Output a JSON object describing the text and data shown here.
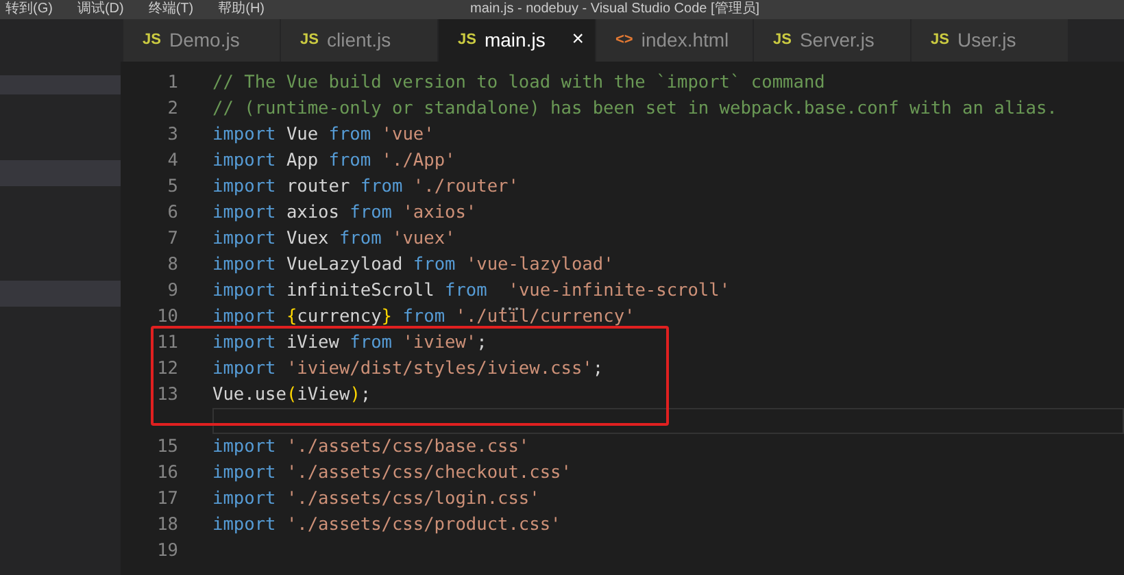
{
  "menu_bar": {
    "items": [
      "转到(G)",
      "调试(D)",
      "终端(T)",
      "帮助(H)"
    ]
  },
  "window": {
    "title": "main.js - nodebuy - Visual Studio Code [管理员]"
  },
  "tabs": [
    {
      "label": "Demo.js",
      "kind": "js",
      "icon": "JS",
      "selected": false
    },
    {
      "label": "client.js",
      "kind": "js",
      "icon": "JS",
      "selected": false
    },
    {
      "label": "main.js",
      "kind": "js",
      "icon": "JS",
      "selected": true,
      "close": "×"
    },
    {
      "label": "index.html",
      "kind": "html",
      "icon": "<>",
      "selected": false
    },
    {
      "label": "Server.js",
      "kind": "js",
      "icon": "JS",
      "selected": false
    },
    {
      "label": "User.js",
      "kind": "js",
      "icon": "JS",
      "selected": false
    }
  ],
  "editor": {
    "lines": [
      {
        "number": "1",
        "tokens": [
          {
            "kind": "comment",
            "text": "// The Vue build version to load with the `import` command"
          }
        ]
      },
      {
        "number": "2",
        "tokens": [
          {
            "kind": "comment",
            "text": "// (runtime-only or standalone) has been set in webpack.base.conf with an alias."
          }
        ]
      },
      {
        "number": "3",
        "tokens": [
          {
            "kind": "keyword",
            "text": "import"
          },
          {
            "kind": "plain",
            "text": " Vue "
          },
          {
            "kind": "keyword",
            "text": "from "
          },
          {
            "kind": "string",
            "text": "'vue'"
          }
        ]
      },
      {
        "number": "4",
        "tokens": [
          {
            "kind": "keyword",
            "text": "import"
          },
          {
            "kind": "plain",
            "text": " App "
          },
          {
            "kind": "keyword",
            "text": "from "
          },
          {
            "kind": "string",
            "text": "'./App'"
          }
        ]
      },
      {
        "number": "5",
        "tokens": [
          {
            "kind": "keyword",
            "text": "import"
          },
          {
            "kind": "plain",
            "text": " router "
          },
          {
            "kind": "keyword",
            "text": "from "
          },
          {
            "kind": "string",
            "text": "'./router'"
          }
        ]
      },
      {
        "number": "6",
        "tokens": [
          {
            "kind": "keyword",
            "text": "import"
          },
          {
            "kind": "plain",
            "text": " axios "
          },
          {
            "kind": "keyword",
            "text": "from "
          },
          {
            "kind": "string",
            "text": "'axios'"
          }
        ]
      },
      {
        "number": "7",
        "tokens": [
          {
            "kind": "keyword",
            "text": "import"
          },
          {
            "kind": "plain",
            "text": " Vuex "
          },
          {
            "kind": "keyword",
            "text": "from "
          },
          {
            "kind": "string",
            "text": "'vuex'"
          }
        ]
      },
      {
        "number": "8",
        "tokens": [
          {
            "kind": "keyword",
            "text": "import"
          },
          {
            "kind": "plain",
            "text": " VueLazyload "
          },
          {
            "kind": "keyword",
            "text": "from "
          },
          {
            "kind": "string",
            "text": "'vue-lazyload'"
          }
        ]
      },
      {
        "number": "9",
        "tokens": [
          {
            "kind": "keyword",
            "text": "import"
          },
          {
            "kind": "plain",
            "text": " infiniteScroll "
          },
          {
            "kind": "keyword",
            "text": "from  "
          },
          {
            "kind": "string",
            "text": "'vue-infinite-scroll'",
            "hint": true
          }
        ]
      },
      {
        "number": "10",
        "tokens": [
          {
            "kind": "keyword",
            "text": "import "
          },
          {
            "kind": "bracket",
            "text": "{"
          },
          {
            "kind": "plain",
            "text": "currency"
          },
          {
            "kind": "bracket",
            "text": "}"
          },
          {
            "kind": "keyword",
            "text": " from "
          },
          {
            "kind": "string",
            "text": "'./util/currency'"
          }
        ]
      },
      {
        "number": "11",
        "boxed": true,
        "tokens": [
          {
            "kind": "keyword",
            "text": "import"
          },
          {
            "kind": "plain",
            "text": " iView "
          },
          {
            "kind": "keyword",
            "text": "from "
          },
          {
            "kind": "string",
            "text": "'iview'"
          },
          {
            "kind": "plain",
            "text": ";"
          }
        ]
      },
      {
        "number": "12",
        "boxed": true,
        "tokens": [
          {
            "kind": "keyword",
            "text": "import "
          },
          {
            "kind": "string",
            "text": "'iview/dist/styles/iview.css'"
          },
          {
            "kind": "plain",
            "text": ";"
          }
        ]
      },
      {
        "number": "13",
        "boxed": true,
        "tokens": [
          {
            "kind": "plain",
            "text": "Vue.use"
          },
          {
            "kind": "bracket",
            "text": "("
          },
          {
            "kind": "plain",
            "text": "iView"
          },
          {
            "kind": "bracket",
            "text": ")"
          },
          {
            "kind": "plain",
            "text": ";"
          }
        ]
      },
      {
        "boxed": true,
        "current": true
      },
      {
        "number": "15",
        "tokens": [
          {
            "kind": "keyword",
            "text": "import "
          },
          {
            "kind": "string",
            "text": "'./assets/css/base.css'"
          }
        ]
      },
      {
        "number": "16",
        "tokens": [
          {
            "kind": "keyword",
            "text": "import "
          },
          {
            "kind": "string",
            "text": "'./assets/css/checkout.css'"
          }
        ]
      },
      {
        "number": "17",
        "tokens": [
          {
            "kind": "keyword",
            "text": "import "
          },
          {
            "kind": "string",
            "text": "'./assets/css/login.css'"
          }
        ]
      },
      {
        "number": "18",
        "tokens": [
          {
            "kind": "keyword",
            "text": "import "
          },
          {
            "kind": "string",
            "text": "'./assets/css/product.css'"
          }
        ]
      },
      {
        "number": "19"
      }
    ]
  }
}
